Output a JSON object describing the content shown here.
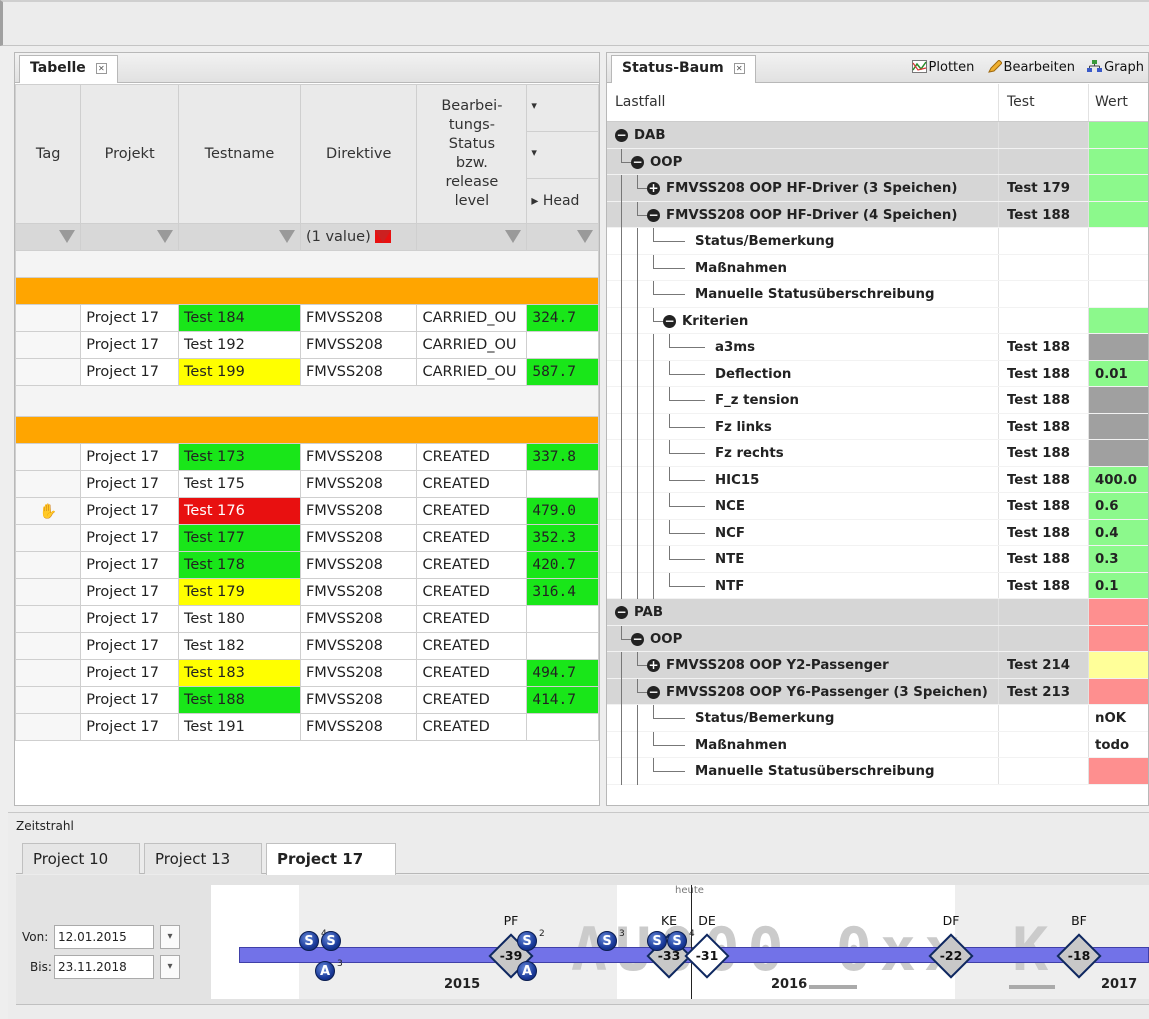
{
  "left_panel": {
    "tab_label": "Tabelle",
    "columns": [
      "Tag",
      "Projekt",
      "Testname",
      "Direktive",
      "Bearbei-\ntungs-\nStatus\nbzw.\nrelease\nlevel"
    ],
    "extra_headers": [
      "▾",
      "▾",
      "▸ Head"
    ],
    "filter_value": "(1 value)",
    "groups": [
      {
        "rows": [
          {
            "tag": "",
            "projekt": "Project 17",
            "testname": "Test 184",
            "color": "green",
            "direktive": "FMVSS208",
            "status": "CARRIED_OU",
            "value": "324.7"
          },
          {
            "tag": "",
            "projekt": "Project 17",
            "testname": "Test 192",
            "color": "",
            "direktive": "FMVSS208",
            "status": "CARRIED_OU",
            "value": ""
          },
          {
            "tag": "",
            "projekt": "Project 17",
            "testname": "Test 199",
            "color": "yellow",
            "direktive": "FMVSS208",
            "status": "CARRIED_OU",
            "value": "587.7"
          }
        ]
      },
      {
        "rows": [
          {
            "tag": "",
            "projekt": "Project 17",
            "testname": "Test 173",
            "color": "green",
            "direktive": "FMVSS208",
            "status": "CREATED",
            "value": "337.8"
          },
          {
            "tag": "",
            "projekt": "Project 17",
            "testname": "Test 175",
            "color": "",
            "direktive": "FMVSS208",
            "status": "CREATED",
            "value": ""
          },
          {
            "tag": "hand",
            "projekt": "Project 17",
            "testname": "Test 176",
            "color": "red",
            "direktive": "FMVSS208",
            "status": "CREATED",
            "value": "479.0"
          },
          {
            "tag": "",
            "projekt": "Project 17",
            "testname": "Test 177",
            "color": "green",
            "direktive": "FMVSS208",
            "status": "CREATED",
            "value": "352.3"
          },
          {
            "tag": "",
            "projekt": "Project 17",
            "testname": "Test 178",
            "color": "green",
            "direktive": "FMVSS208",
            "status": "CREATED",
            "value": "420.7"
          },
          {
            "tag": "",
            "projekt": "Project 17",
            "testname": "Test 179",
            "color": "yellow",
            "direktive": "FMVSS208",
            "status": "CREATED",
            "value": "316.4"
          },
          {
            "tag": "",
            "projekt": "Project 17",
            "testname": "Test 180",
            "color": "",
            "direktive": "FMVSS208",
            "status": "CREATED",
            "value": ""
          },
          {
            "tag": "",
            "projekt": "Project 17",
            "testname": "Test 182",
            "color": "",
            "direktive": "FMVSS208",
            "status": "CREATED",
            "value": ""
          },
          {
            "tag": "",
            "projekt": "Project 17",
            "testname": "Test 183",
            "color": "yellow",
            "direktive": "FMVSS208",
            "status": "CREATED",
            "value": "494.7"
          },
          {
            "tag": "",
            "projekt": "Project 17",
            "testname": "Test 188",
            "color": "green",
            "direktive": "FMVSS208",
            "status": "CREATED",
            "value": "414.7"
          },
          {
            "tag": "",
            "projekt": "Project 17",
            "testname": "Test 191",
            "color": "",
            "direktive": "FMVSS208",
            "status": "CREATED",
            "value": ""
          }
        ]
      }
    ]
  },
  "right_panel": {
    "tab_label": "Status-Baum",
    "tools": {
      "plot": "Plotten",
      "edit": "Bearbeiten",
      "graph": "Graph"
    },
    "columns": {
      "lastfall": "Lastfall",
      "test": "Test",
      "wert": "Wert"
    },
    "rows": [
      {
        "label": "DAB",
        "level": 0,
        "node": "minus",
        "grey": true,
        "test": "",
        "wert": "",
        "color": "vg"
      },
      {
        "label": "OOP",
        "level": 1,
        "node": "minus",
        "grey": true,
        "test": "",
        "wert": "",
        "color": "vg"
      },
      {
        "label": "FMVSS208 OOP HF-Driver (3 Speichen)",
        "level": 2,
        "node": "plus",
        "grey": true,
        "test": "Test 179",
        "wert": "",
        "color": "vg"
      },
      {
        "label": "FMVSS208 OOP HF-Driver (4 Speichen)",
        "level": 2,
        "node": "minus",
        "grey": true,
        "test": "Test 188",
        "wert": "",
        "color": "vg"
      },
      {
        "label": "Status/Bemerkung",
        "level": 3,
        "node": "",
        "grey": false,
        "test": "",
        "wert": "",
        "color": ""
      },
      {
        "label": "Maßnahmen",
        "level": 3,
        "node": "",
        "grey": false,
        "test": "",
        "wert": "",
        "color": ""
      },
      {
        "label": "Manuelle Statusüberschreibung",
        "level": 3,
        "node": "",
        "grey": false,
        "test": "",
        "wert": "",
        "color": ""
      },
      {
        "label": "Kriterien",
        "level": 3,
        "node": "minus",
        "grey": false,
        "test": "",
        "wert": "",
        "color": "vg"
      },
      {
        "label": "a3ms",
        "level": 4,
        "node": "",
        "grey": false,
        "test": "Test 188",
        "wert": "",
        "color": "vgr"
      },
      {
        "label": "Deflection",
        "level": 4,
        "node": "",
        "grey": false,
        "test": "Test 188",
        "wert": "0.01",
        "color": "vg"
      },
      {
        "label": "F_z tension",
        "level": 4,
        "node": "",
        "grey": false,
        "test": "Test 188",
        "wert": "",
        "color": "vgr"
      },
      {
        "label": "Fz links",
        "level": 4,
        "node": "",
        "grey": false,
        "test": "Test 188",
        "wert": "",
        "color": "vgr"
      },
      {
        "label": "Fz rechts",
        "level": 4,
        "node": "",
        "grey": false,
        "test": "Test 188",
        "wert": "",
        "color": "vgr"
      },
      {
        "label": "HIC15",
        "level": 4,
        "node": "",
        "grey": false,
        "test": "Test 188",
        "wert": "400.0",
        "color": "vg"
      },
      {
        "label": "NCE",
        "level": 4,
        "node": "",
        "grey": false,
        "test": "Test 188",
        "wert": "0.6",
        "color": "vg"
      },
      {
        "label": "NCF",
        "level": 4,
        "node": "",
        "grey": false,
        "test": "Test 188",
        "wert": "0.4",
        "color": "vg"
      },
      {
        "label": "NTE",
        "level": 4,
        "node": "",
        "grey": false,
        "test": "Test 188",
        "wert": "0.3",
        "color": "vg"
      },
      {
        "label": "NTF",
        "level": 4,
        "node": "",
        "grey": false,
        "test": "Test 188",
        "wert": "0.1",
        "color": "vg"
      },
      {
        "label": "PAB",
        "level": 0,
        "node": "minus",
        "grey": true,
        "test": "",
        "wert": "",
        "color": "vr"
      },
      {
        "label": "OOP",
        "level": 1,
        "node": "minus",
        "grey": true,
        "test": "",
        "wert": "",
        "color": "vr"
      },
      {
        "label": "FMVSS208 OOP Y2-Passenger",
        "level": 2,
        "node": "plus",
        "grey": true,
        "test": "Test 214",
        "wert": "",
        "color": "vy"
      },
      {
        "label": "FMVSS208 OOP Y6-Passenger (3 Speichen)",
        "level": 2,
        "node": "minus",
        "grey": true,
        "test": "Test 213",
        "wert": "",
        "color": "vr"
      },
      {
        "label": "Status/Bemerkung",
        "level": 3,
        "node": "",
        "grey": false,
        "test": "",
        "wert": "nOK",
        "color": ""
      },
      {
        "label": "Maßnahmen",
        "level": 3,
        "node": "",
        "grey": false,
        "test": "",
        "wert": "todo",
        "color": ""
      },
      {
        "label": "Manuelle Statusüberschreibung",
        "level": 3,
        "node": "",
        "grey": false,
        "test": "",
        "wert": "",
        "color": "vr"
      }
    ]
  },
  "timeline": {
    "title": "Zeitstrahl",
    "tabs": [
      "Project 10",
      "Project 13",
      "Project 17"
    ],
    "active_tab": 2,
    "von_label": "Von:",
    "von_value": "12.01.2015",
    "bis_label": "Bis:",
    "bis_value": "23.11.2018",
    "today_label": "heute",
    "watermark": "AU000  0xx  K",
    "years": [
      "2015",
      "2016",
      "2017"
    ],
    "milestones": [
      {
        "label": "PF",
        "value": "-39"
      },
      {
        "label": "KE",
        "value": "-33"
      },
      {
        "label": "DE",
        "value": "-31"
      },
      {
        "label": "DF",
        "value": "-22"
      },
      {
        "label": "BF",
        "value": "-18"
      }
    ],
    "markers": [
      {
        "letter": "S",
        "sup": "4"
      },
      {
        "letter": "S",
        "sup": ""
      },
      {
        "letter": "A",
        "sup": "3"
      },
      {
        "letter": "S",
        "sup": "2"
      },
      {
        "letter": "A",
        "sup": ""
      },
      {
        "letter": "S",
        "sup": "3"
      },
      {
        "letter": "S",
        "sup": ""
      },
      {
        "letter": "S",
        "sup": "4"
      }
    ]
  }
}
